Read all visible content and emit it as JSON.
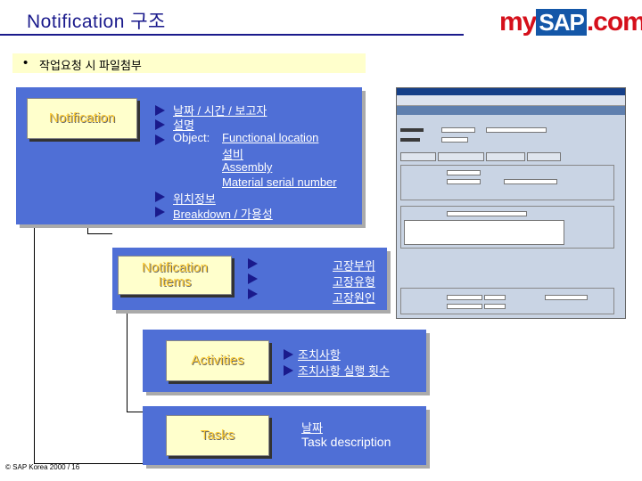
{
  "header": {
    "title": "Notification 구조",
    "logo_my": "my",
    "logo_sap": "SAP",
    "logo_com": ".com",
    "logo_tm": "™"
  },
  "bullet": {
    "text": "작업요청 시 파일첨부"
  },
  "notification": {
    "label": "Notification",
    "items": [
      "날짜 / 시간 / 보고자",
      "설명",
      "Object:",
      "Functional location",
      "설비",
      "Assembly",
      "Material serial number",
      "위치정보",
      "Breakdown / 가용성"
    ]
  },
  "notification_items": {
    "label": "Notification Items",
    "items": [
      "고장부위",
      "고장유형",
      "고장원인"
    ]
  },
  "activities": {
    "label": "Activities",
    "items": [
      "조치사항",
      "조치사항 실행 횟수"
    ]
  },
  "tasks": {
    "label": "Tasks",
    "items": [
      "날짜",
      "Task description"
    ]
  },
  "footer": {
    "copyright_symbol": "©",
    "text": "SAP Korea 2000 /  16"
  },
  "colors": {
    "panel": "#4f6fd6",
    "box_fill": "#ffffcc",
    "box_text": "#ffcc33",
    "title": "#1a1a8c",
    "bullet_bar": "#ffffcc"
  }
}
